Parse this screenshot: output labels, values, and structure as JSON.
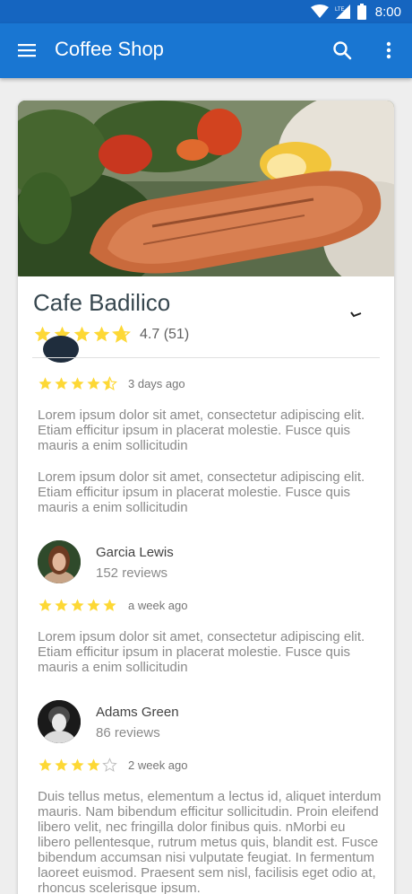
{
  "status_bar": {
    "time": "8:00",
    "network": "LTE"
  },
  "app_bar": {
    "title": "Coffee Shop",
    "menu_icon": "menu-icon",
    "search_icon": "search-icon",
    "more_icon": "more-vert-icon"
  },
  "place": {
    "name": "Cafe Badilico",
    "rating": 4.7,
    "rating_text": "4.7 (51)"
  },
  "colors": {
    "primary_dark": "#1565c0",
    "primary": "#1976d2",
    "star": "#fdd835",
    "star_empty": "#bdbdbd"
  },
  "reviews": [
    {
      "stars": 4.5,
      "time": "3 days ago",
      "paragraphs": [
        "Lorem ipsum dolor sit amet, consectetur adipiscing elit. Etiam efficitur ipsum in placerat molestie.  Fusce quis mauris a enim sollicitudin",
        "Lorem ipsum dolor sit amet, consectetur adipiscing elit. Etiam efficitur ipsum in placerat molestie.  Fusce quis mauris a enim sollicitudin"
      ]
    },
    {
      "name": "Garcia Lewis",
      "count": "152 reviews",
      "stars": 5,
      "time": "a week ago",
      "paragraphs": [
        "Lorem ipsum dolor sit amet, consectetur adipiscing elit. Etiam efficitur ipsum in placerat molestie.  Fusce quis mauris a enim sollicitudin"
      ]
    },
    {
      "name": "Adams Green",
      "count": "86 reviews",
      "stars": 4,
      "time": "2 week ago",
      "paragraphs": [
        "Duis tellus metus, elementum a lectus id, aliquet interdum mauris. Nam bibendum efficitur sollicitudin. Proin eleifend libero velit, nec fringilla dolor finibus quis. nMorbi eu libero pellentesque, rutrum metus quis, blandit est. Fusce bibendum accumsan nisi vulputate feugiat. In fermentum laoreet euismod. Praesent sem nisl, facilisis eget odio at, rhoncus scelerisque ipsum."
      ]
    }
  ]
}
